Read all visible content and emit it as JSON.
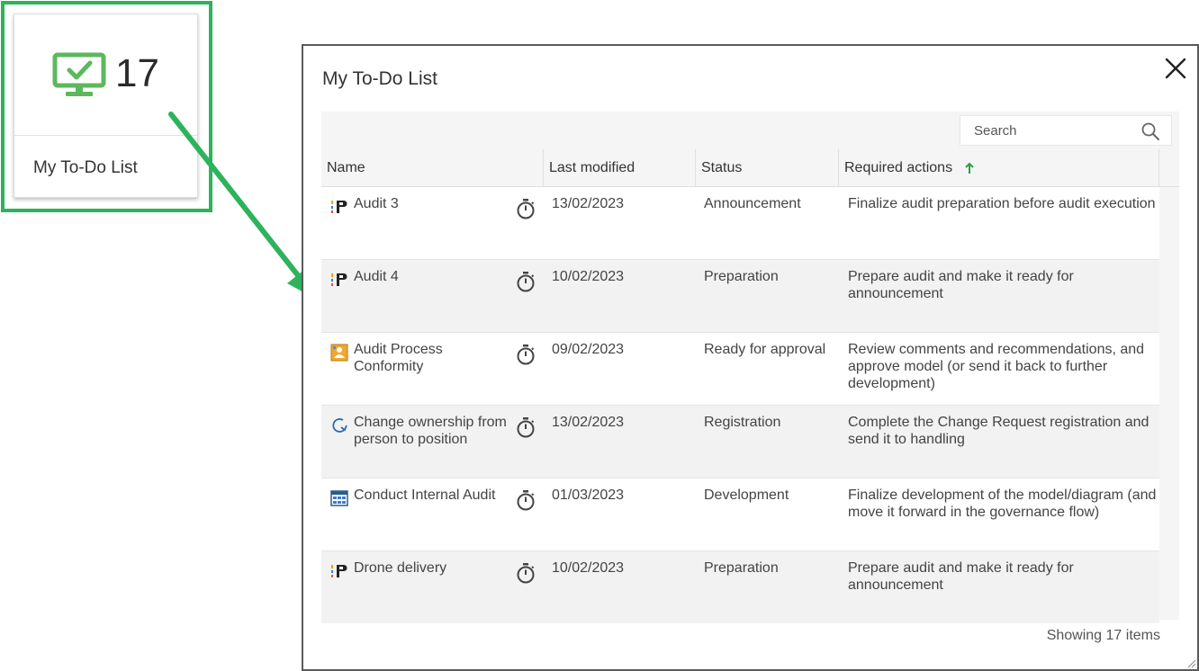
{
  "widget": {
    "count": "17",
    "label": "My To-Do List",
    "icon": "monitor-check-icon"
  },
  "dialog": {
    "title": "My To-Do List",
    "close_icon": "close-icon",
    "search": {
      "placeholder": "Search",
      "icon": "search-icon"
    },
    "columns": {
      "name": "Name",
      "last_modified": "Last modified",
      "status": "Status",
      "required_actions": "Required actions"
    },
    "sort": {
      "column": "required_actions",
      "direction": "ascending"
    },
    "rows": [
      {
        "icon": "audit-icon",
        "name": "Audit 3",
        "last_modified": "13/02/2023",
        "status": "Announcement",
        "required_actions": "Finalize audit preparation before audit execution"
      },
      {
        "icon": "audit-icon",
        "name": "Audit 4",
        "last_modified": "10/02/2023",
        "status": "Preparation",
        "required_actions": "Prepare audit and make it ready for announcement"
      },
      {
        "icon": "process-model-icon",
        "name": "Audit Process Conformity",
        "last_modified": "09/02/2023",
        "status": "Ready for approval",
        "required_actions": "Review comments and recommendations, and approve model (or send it back to further development)"
      },
      {
        "icon": "change-request-icon",
        "name": "Change ownership from person to position",
        "last_modified": "13/02/2023",
        "status": "Registration",
        "required_actions": "Complete the Change Request registration and send it to handling"
      },
      {
        "icon": "diagram-icon",
        "name": "Conduct Internal Audit",
        "last_modified": "01/03/2023",
        "status": "Development",
        "required_actions": "Finalize development of the model/diagram (and move it forward in the governance flow)"
      },
      {
        "icon": "audit-icon",
        "name": "Drone delivery",
        "last_modified": "10/02/2023",
        "status": "Preparation",
        "required_actions": "Prepare audit and make it ready for announcement"
      }
    ],
    "footer": "Showing 17 items"
  },
  "colors": {
    "highlight_green": "#2db35c",
    "widget_icon_green": "#5cb85c",
    "sort_arrow_green": "#2aa04a"
  }
}
